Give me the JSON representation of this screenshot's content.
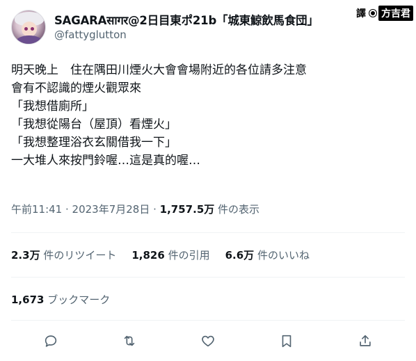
{
  "author": {
    "display_name": "SAGARAसागर@2日目東ポ21b「城東鯨飲馬食団」",
    "handle": "@fattyglutton"
  },
  "translator": {
    "prefix": "譯",
    "name": "方吉君"
  },
  "tweet": {
    "lines": [
      "明天晚上　住在隅田川煙火大會會場附近的各位請多注意",
      "會有不認識的煙火觀眾來",
      "「我想借廁所」",
      "「我想從陽台（屋頂）看煙火」",
      "「我想整理浴衣玄關借我一下」",
      "一大堆人來按門鈴喔…這是真的喔…"
    ]
  },
  "meta": {
    "time": "午前11:41",
    "sep1": " · ",
    "date": "2023年7月28日",
    "sep2": " · ",
    "views_count": "1,757.5万",
    "views_label": " 件の表示"
  },
  "stats": {
    "retweets_count": "2.3万",
    "retweets_label": " 件のリツイート",
    "quotes_count": "1,826",
    "quotes_label": " 件の引用",
    "likes_count": "6.6万",
    "likes_label": " 件のいいね"
  },
  "bookmarks": {
    "count": "1,673",
    "label": " ブックマーク"
  },
  "actions": [
    "reply-icon",
    "retweet-icon",
    "like-icon",
    "bookmark-icon",
    "share-icon"
  ]
}
